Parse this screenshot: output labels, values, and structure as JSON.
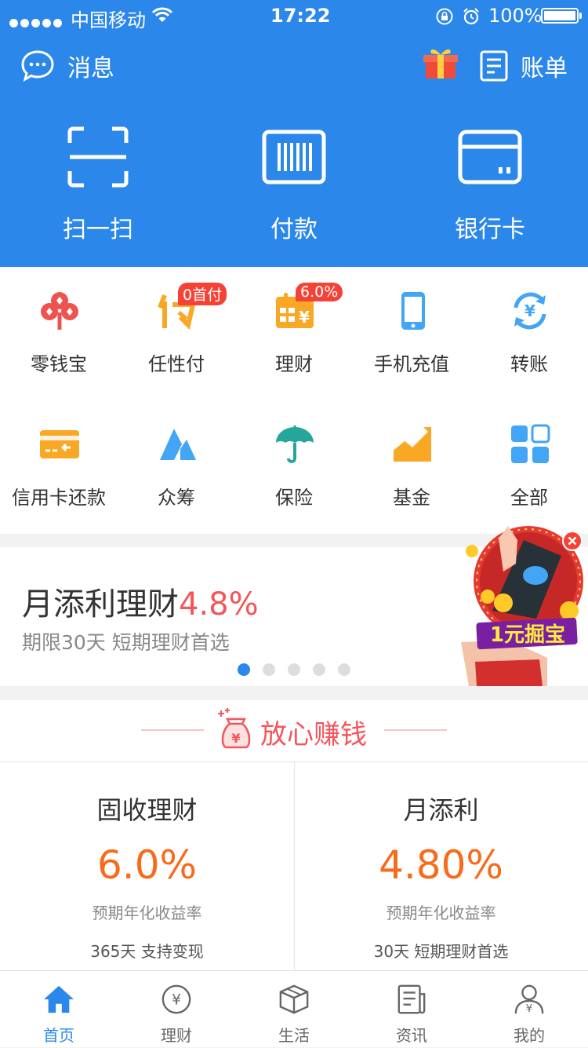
{
  "status_bar": {
    "carrier": "中国移动",
    "time": "17:22",
    "battery": "100%"
  },
  "header": {
    "messages_label": "消息",
    "bill_label": "账单",
    "quick_actions": [
      {
        "label": "扫一扫",
        "icon": "scan-icon"
      },
      {
        "label": "付款",
        "icon": "barcode-icon"
      },
      {
        "label": "银行卡",
        "icon": "bank-card-icon"
      }
    ]
  },
  "grid": {
    "items": [
      {
        "label": "零钱宝",
        "icon": "clover-icon"
      },
      {
        "label": "任性付",
        "icon": "renxingfu-icon",
        "badge": "0首付"
      },
      {
        "label": "理财",
        "icon": "calendar-yuan-icon",
        "badge": "6.0%"
      },
      {
        "label": "手机充值",
        "icon": "phone-icon"
      },
      {
        "label": "转账",
        "icon": "transfer-icon"
      },
      {
        "label": "信用卡还款",
        "icon": "credit-card-icon"
      },
      {
        "label": "众筹",
        "icon": "crowdfunding-icon"
      },
      {
        "label": "保险",
        "icon": "umbrella-icon"
      },
      {
        "label": "基金",
        "icon": "fund-chart-icon"
      },
      {
        "label": "全部",
        "icon": "all-apps-icon"
      }
    ]
  },
  "banner": {
    "title": "月添利理财",
    "rate": "4.8%",
    "subtitle": "期限30天 短期理财首选",
    "page_count": 5,
    "active_page": 0
  },
  "promo": {
    "label": "1元掘宝"
  },
  "section": {
    "title": "放心赚钱",
    "cards": [
      {
        "title": "固收理财",
        "rate": "6.0%",
        "rate_label": "预期年化收益率",
        "desc": "365天 支持变现"
      },
      {
        "title": "月添利",
        "rate": "4.80%",
        "rate_label": "预期年化收益率",
        "desc": "30天 短期理财首选"
      }
    ]
  },
  "tab_bar": {
    "tabs": [
      {
        "label": "首页",
        "icon": "home-icon",
        "active": true
      },
      {
        "label": "理财",
        "icon": "yuan-circle-icon",
        "active": false
      },
      {
        "label": "生活",
        "icon": "box-icon",
        "active": false
      },
      {
        "label": "资讯",
        "icon": "news-icon",
        "active": false
      },
      {
        "label": "我的",
        "icon": "user-icon",
        "active": false
      }
    ]
  },
  "colors": {
    "brand_blue": "#2b87e9",
    "accent_red": "#f4555a",
    "rate_orange": "#f76b1c"
  }
}
